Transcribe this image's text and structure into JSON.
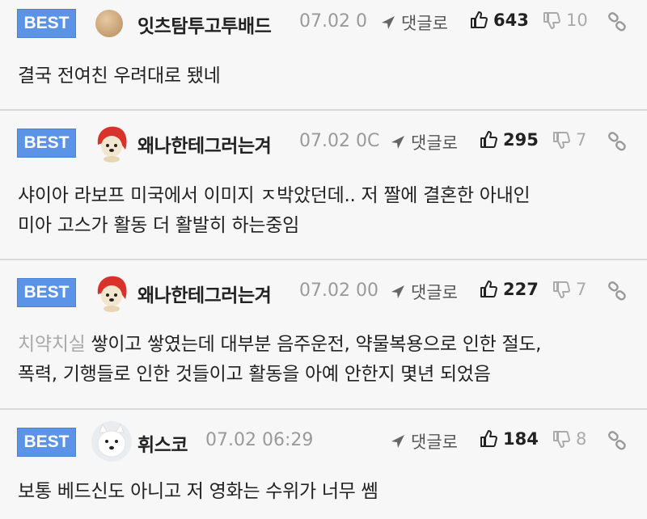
{
  "comments": [
    {
      "badge": "BEST",
      "nickname": "잇츠탐투고투배드",
      "date": "07.02 0",
      "reply_label": "댓글로",
      "likes": "643",
      "dislikes": "10",
      "body": "결국 전여친 우려대로 됐네",
      "avatar": "round-beige-avatar"
    },
    {
      "badge": "BEST",
      "nickname": "왜나한테그러는겨",
      "date": "07.02 0C",
      "reply_label": "댓글로",
      "likes": "295",
      "dislikes": "7",
      "body_line1": "샤이아 라보프 미국에서 이미지 ㅈ박았던데.. 저 짤에 결혼한 아내인",
      "body_line2": "미아 고스가 활동 더 활발히 하는중임",
      "avatar": "puppy-red-hood-avatar"
    },
    {
      "badge": "BEST",
      "nickname": "왜나한테그러는겨",
      "date": "07.02 00",
      "reply_label": "댓글로",
      "likes": "227",
      "dislikes": "7",
      "body_gray_prefix": "치약치실",
      "body_line1_rest": " 쌓이고 쌓였는데 대부분 음주운전, 약물복용으로 인한 절도,",
      "body_line2": "폭력, 기행들로 인한 것들이고 활동을 아예 안한지 몇년 되었음",
      "avatar": "puppy-red-hood-avatar"
    },
    {
      "badge": "BEST",
      "nickname": "휘스코",
      "date": "07.02 06:29",
      "reply_label": "댓글로",
      "likes": "184",
      "dislikes": "8",
      "body": "보통 베드신도 아니고 저 영화는 수위가 너무 쎔",
      "avatar": "white-dog-avatar"
    }
  ],
  "colors": {
    "badge_blue": "#5b93e6",
    "background": "#f7f7f7",
    "divider": "#d9d9d9"
  }
}
